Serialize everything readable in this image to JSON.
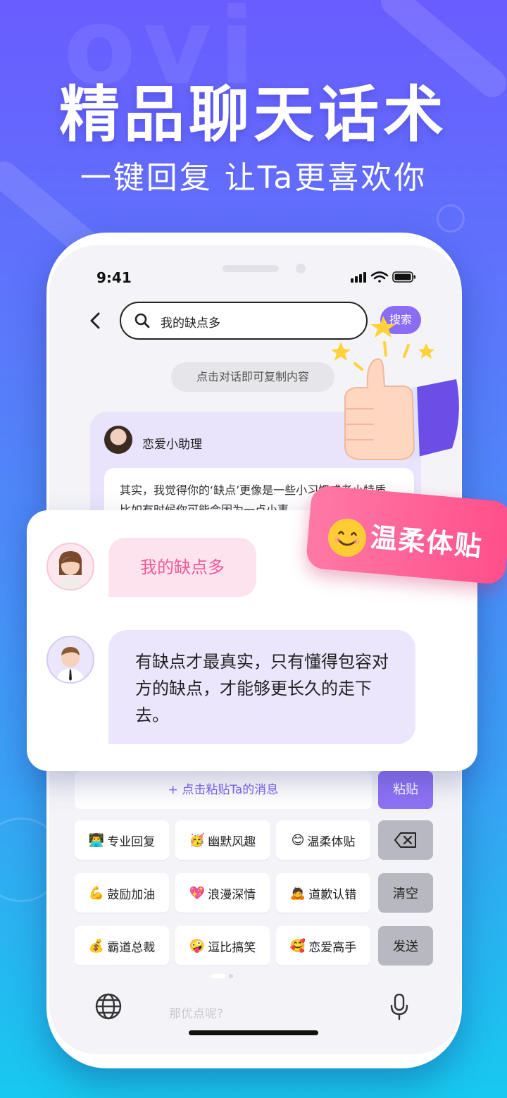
{
  "hero": {
    "title": "精品聊天话术",
    "subtitle": "一键回复 让Ta更喜欢你"
  },
  "status_bar": {
    "time": "9:41"
  },
  "search": {
    "query": "我的缺点多",
    "button": "搜索"
  },
  "hint": "点击对话即可复制内容",
  "assistant": {
    "name": "恋爱小助理",
    "message": "其实，我觉得你的‘缺点’更像是一些小习惯或者小特质，比如有时候你可能会因为一点小事"
  },
  "badge": {
    "label": "温柔体贴",
    "icon": "smile-emoji-icon"
  },
  "chat": {
    "user_message": "我的缺点多",
    "reply_message": "有缺点才最真实，只有懂得包容对方的缺点，才能够更长久的走下去。"
  },
  "keyboard": {
    "paste_bar": "+ 点击粘贴Ta的消息",
    "paste_button": "粘贴",
    "clear_button": "清空",
    "send_button": "发送",
    "delete_icon": "backspace-icon",
    "input_ghost": "那优点呢?",
    "styles": [
      {
        "emoji": "👨‍💻",
        "label": "专业回复"
      },
      {
        "emoji": "🥳",
        "label": "幽默风趣"
      },
      {
        "emoji": "😊",
        "label": "温柔体贴"
      },
      {
        "emoji": "💪",
        "label": "鼓励加油"
      },
      {
        "emoji": "💖",
        "label": "浪漫深情"
      },
      {
        "emoji": "🙇",
        "label": "道歉认错"
      },
      {
        "emoji": "💰",
        "label": "霸道总裁"
      },
      {
        "emoji": "🤪",
        "label": "逗比搞笑"
      },
      {
        "emoji": "🥰",
        "label": "恋爱高手"
      }
    ]
  },
  "colors": {
    "accent_purple": "#8b6cf5",
    "badge_pink": "#ff5a92",
    "bubble_pink": "#fde3ee",
    "bubble_purple": "#ebe6fb"
  }
}
